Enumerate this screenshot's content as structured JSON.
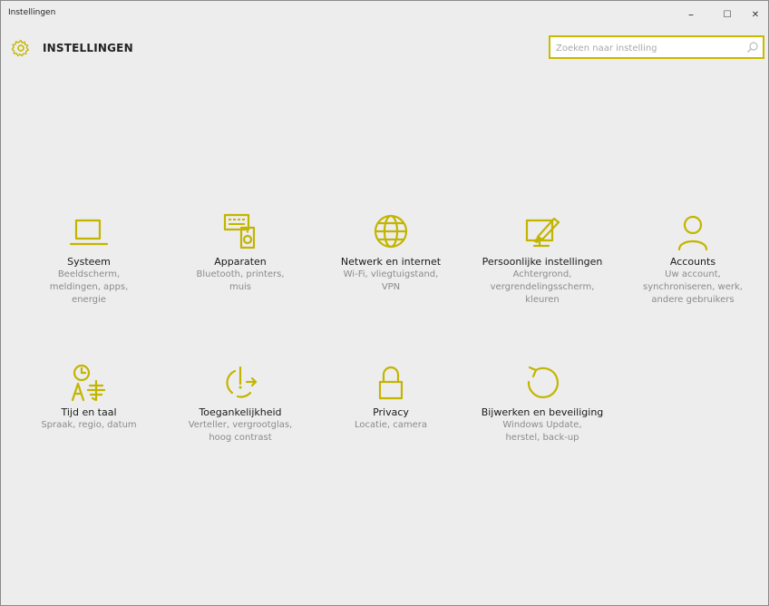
{
  "window": {
    "title": "Instellingen",
    "controls": {
      "minimize": "–",
      "maximize": "☐",
      "close": "✕"
    }
  },
  "header": {
    "title": "INSTELLINGEN",
    "icon": "gear-icon"
  },
  "search": {
    "placeholder": "Zoeken naar instelling",
    "value": "",
    "icon": "search-icon"
  },
  "colors": {
    "accent": "#c2b500",
    "background": "#ededed",
    "name_text": "#1a1a1a",
    "desc_text": "#8b8b8b"
  },
  "tiles": [
    {
      "name": "Systeem",
      "desc": [
        "Beeldscherm,",
        "meldingen, apps,",
        "energie"
      ],
      "icon": "laptop-icon"
    },
    {
      "name": "Apparaten",
      "desc": [
        "Bluetooth, printers,",
        "muis"
      ],
      "icon": "devices-icon"
    },
    {
      "name": "Netwerk en internet",
      "desc": [
        "Wi-Fi, vliegtuigstand,",
        "VPN"
      ],
      "icon": "globe-icon"
    },
    {
      "name": "Persoonlijke instellingen",
      "desc": [
        "Achtergrond,",
        "vergrendelingsscherm,",
        "kleuren"
      ],
      "icon": "personalization-icon"
    },
    {
      "name": "Accounts",
      "desc": [
        "Uw account,",
        "synchroniseren, werk,",
        "andere gebruikers"
      ],
      "icon": "person-icon"
    },
    {
      "name": "Tijd en taal",
      "desc": [
        "Spraak, regio, datum"
      ],
      "icon": "time-language-icon"
    },
    {
      "name": "Toegankelijkheid",
      "desc": [
        "Verteller, vergrootglas,",
        "hoog contrast"
      ],
      "icon": "accessibility-icon"
    },
    {
      "name": "Privacy",
      "desc": [
        "Locatie, camera"
      ],
      "icon": "lock-icon"
    },
    {
      "name": "Bijwerken en beveiliging",
      "desc": [
        "Windows Update,",
        "herstel, back-up"
      ],
      "icon": "update-icon"
    }
  ]
}
